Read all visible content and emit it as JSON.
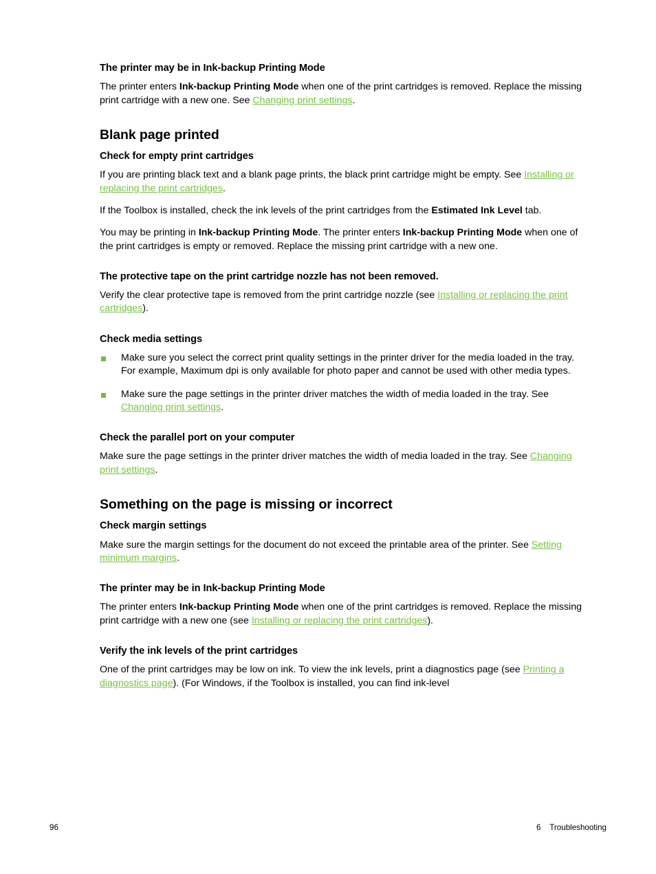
{
  "page": {
    "number": "96",
    "chapter_number": "6",
    "chapter_name": "Troubleshooting"
  },
  "colors": {
    "link": "#79c143",
    "bullet": "#7bb648",
    "text": "#000000",
    "background": "#ffffff"
  },
  "sections": {
    "ink_backup_1": {
      "heading": "The printer may be in Ink-backup Printing Mode",
      "para": {
        "t1": "The printer enters ",
        "b1": "Ink-backup Printing Mode",
        "t2": " when one of the print cartridges is removed. Replace the missing print cartridge with a new one. See ",
        "link1": "Changing print settings",
        "t3": "."
      }
    },
    "blank_page": {
      "heading": "Blank page printed"
    },
    "empty_cartridges": {
      "heading": "Check for empty print cartridges",
      "para1": {
        "t1": "If you are printing black text and a blank page prints, the black print cartridge might be empty. See ",
        "link1": "Installing or replacing the print cartridges",
        "t2": "."
      },
      "para2": {
        "t1": "If the Toolbox is installed, check the ink levels of the print cartridges from the ",
        "b1": "Estimated Ink Level",
        "t2": " tab."
      },
      "para3": {
        "t1": "You may be printing in ",
        "b1": "Ink-backup Printing Mode",
        "t2": ". The printer enters ",
        "b2": "Ink-backup Printing Mode",
        "t3": " when one of the print cartridges is empty or removed. Replace the missing print cartridge with a new one."
      }
    },
    "protective_tape": {
      "heading": "The protective tape on the print cartridge nozzle has not been removed.",
      "para": {
        "t1": "Verify the clear protective tape is removed from the print cartridge nozzle (see ",
        "link1": "Installing or replacing the print cartridges",
        "t2": ")."
      }
    },
    "media_settings": {
      "heading": "Check media settings",
      "bullets": [
        {
          "t1": "Make sure you select the correct print quality settings in the printer driver for the media loaded in the tray. For example, Maximum dpi is only available for photo paper and cannot be used with other media types."
        },
        {
          "t1": "Make sure the page settings in the printer driver matches the width of media loaded in the tray. See ",
          "link1": "Changing print settings",
          "t2": "."
        }
      ]
    },
    "parallel_port": {
      "heading": "Check the parallel port on your computer",
      "para": {
        "t1": "Make sure the page settings in the printer driver matches the width of media loaded in the tray. See ",
        "link1": "Changing print settings",
        "t2": "."
      }
    },
    "missing_incorrect": {
      "heading": "Something on the page is missing or incorrect"
    },
    "margin_settings": {
      "heading": "Check margin settings",
      "para": {
        "t1": "Make sure the margin settings for the document do not exceed the printable area of the printer. See ",
        "link1": "Setting minimum margins",
        "t2": "."
      }
    },
    "ink_backup_2": {
      "heading": "The printer may be in Ink-backup Printing Mode",
      "para": {
        "t1": "The printer enters ",
        "b1": "Ink-backup Printing Mode",
        "t2": " when one of the print cartridges is removed. Replace the missing print cartridge with a new one (see ",
        "link1": "Installing or replacing the print cartridges",
        "t3": ")."
      }
    },
    "verify_ink_levels": {
      "heading": "Verify the ink levels of the print cartridges",
      "para": {
        "t1": "One of the print cartridges may be low on ink. To view the ink levels, print a diagnostics page (see ",
        "link1": "Printing a diagnostics page",
        "t2": "). (For Windows, if the Toolbox is installed, you can find ink-level"
      }
    }
  }
}
